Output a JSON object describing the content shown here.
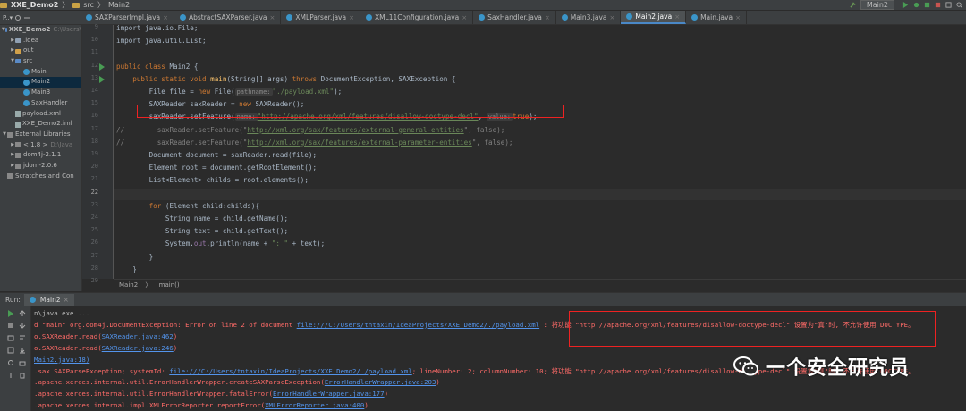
{
  "navbar": {
    "project": "XXE_Demo2",
    "sep": "〉",
    "folder": "src",
    "file": "Main2",
    "run_config": "Main2"
  },
  "project_tab": {
    "label": "P..▾"
  },
  "tabs": [
    {
      "label": "SAXParserImpl.java",
      "active": false
    },
    {
      "label": "AbstractSAXParser.java",
      "active": false
    },
    {
      "label": "XMLParser.java",
      "active": false
    },
    {
      "label": "XML11Configuration.java",
      "active": false
    },
    {
      "label": "SaxHandler.java",
      "active": false
    },
    {
      "label": "Main3.java",
      "active": false
    },
    {
      "label": "Main2.java",
      "active": true
    },
    {
      "label": "Main.java",
      "active": false
    }
  ],
  "tree": [
    {
      "indent": 0,
      "tri": "▼",
      "icon": "folder-blue",
      "label": "XXE_Demo2",
      "hint": "C:\\Users\\",
      "sel": false,
      "bold": true
    },
    {
      "indent": 1,
      "tri": "▶",
      "icon": "folder",
      "label": ".idea",
      "sel": false
    },
    {
      "indent": 1,
      "tri": "▶",
      "icon": "folder-orange",
      "label": "out",
      "sel": false
    },
    {
      "indent": 1,
      "tri": "▼",
      "icon": "folder-blue",
      "label": "src",
      "sel": false
    },
    {
      "indent": 2,
      "tri": "",
      "icon": "class",
      "label": "Main",
      "sel": false
    },
    {
      "indent": 2,
      "tri": "",
      "icon": "class",
      "label": "Main2",
      "sel": true
    },
    {
      "indent": 2,
      "tri": "",
      "icon": "class",
      "label": "Main3",
      "sel": false
    },
    {
      "indent": 2,
      "tri": "",
      "icon": "class",
      "label": "SaxHandler",
      "sel": false
    },
    {
      "indent": 1,
      "tri": "",
      "icon": "file",
      "label": "payload.xml",
      "sel": false
    },
    {
      "indent": 1,
      "tri": "",
      "icon": "file",
      "label": "XXE_Demo2.iml",
      "sel": false
    },
    {
      "indent": 0,
      "tri": "▼",
      "icon": "lib",
      "label": "External Libraries",
      "sel": false
    },
    {
      "indent": 1,
      "tri": "▶",
      "icon": "lib",
      "label": "< 1.8 >",
      "hint": "D:\\Java",
      "sel": false
    },
    {
      "indent": 1,
      "tri": "▶",
      "icon": "lib",
      "label": "dom4j-2.1.1",
      "sel": false
    },
    {
      "indent": 1,
      "tri": "▶",
      "icon": "lib",
      "label": "jdom-2.0.6",
      "sel": false
    },
    {
      "indent": 0,
      "tri": "",
      "icon": "lib",
      "label": "Scratches and Con",
      "sel": false
    }
  ],
  "editor": {
    "line_numbers": [
      "9",
      "10",
      "11",
      "12",
      "13",
      "14",
      "15",
      "16",
      "17",
      "18",
      "19",
      "20",
      "21",
      "22",
      "23",
      "24",
      "25",
      "26",
      "27",
      "28",
      "29"
    ],
    "lines": {
      "l9": "import java.io.File;",
      "l10": "import java.util.List;",
      "l12a": "public class ",
      "l12b": "Main2 {",
      "l13a": "    public static void ",
      "l13b": "main",
      "l13c": "(String[] args) ",
      "l13d": "throws ",
      "l13e": "DocumentException, SAXException {",
      "l14a": "        File file = ",
      "l14b": "new ",
      "l14c": "File(",
      "l14hint": "pathname:",
      "l14d": "\"./payload.xml\"",
      "l14e": ");",
      "l15a": "        SAXReader saxReader = ",
      "l15b": "new ",
      "l15c": "SAXReader();",
      "l16a": "        saxReader.setFeature(",
      "l16hint1": "name:",
      "l16b": "\"http://apache.org/xml/features/disallow-doctype-decl\"",
      "l16c": ", ",
      "l16hint2": "value:",
      "l16d": "true",
      "l16e": ");",
      "l17a": "//",
      "l17b": "        saxReader.setFeature(\"",
      "l17c": "http://xml.org/sax/features/external-general-entities",
      "l17d": "\", false);",
      "l18a": "//",
      "l18b": "        saxReader.setFeature(\"",
      "l18c": "http://xml.org/sax/features/external-parameter-entities",
      "l18d": "\", false);",
      "l19": "        Document document = saxReader.read(file);",
      "l20": "        Element root = document.getRootElement();",
      "l21a": "        List<Element> ",
      "l21b": "childs",
      "l21c": " = root.elements();",
      "l23a": "        ",
      "l23b": "for ",
      "l23c": "(Element child:childs){",
      "l24": "            String name = child.getName();",
      "l25": "            String text = child.getText();",
      "l26a": "            System.",
      "l26b": "out",
      "l26c": ".println(name + ",
      "l26d": "\": \"",
      "l26e": " + text);",
      "l27": "        }",
      "l28": "    }",
      "l29": "}"
    },
    "breadcrumb": [
      "Main2",
      "〉",
      "main()"
    ]
  },
  "run": {
    "label": "Run:",
    "tab": "Main2",
    "console": {
      "c1": "n\\java.exe ...",
      "c2a": "d \"main\" org.dom4j.DocumentException: Error on line 2 of document ",
      "c2b": "file:///C:/Users/tntaxin/IdeaProjects/XXE_Demo2/./payload.xml",
      "c2c": " : 将功能 \"http://apache.org/xml/features/disallow-doctype-decl\" 设置为\"真\"时, 不允许使用 DOCTYPE。",
      "c3a": "o.SAXReader.read(",
      "c3b": "SAXReader.java:462",
      "c3c": ")",
      "c4a": "o.SAXReader.read(",
      "c4b": "SAXReader.java:246",
      "c4c": ")",
      "c5": "Main2.java:18)",
      "c6a": ".sax.SAXParseException; systemId: ",
      "c6b": "file:///C:/Users/tntaxin/IdeaProjects/XXE_Demo2/./payload.xml",
      "c6c": "; lineNumber: 2; columnNumber: 10; 将功能 \"http://apache.org/xml/features/disallow-doctype-decl\" 设置为\"真\"时, 不允许使用 DOCTYPE。",
      "c7a": ".apache.xerces.internal.util.ErrorHandlerWrapper.createSAXParseException(",
      "c7b": "ErrorHandlerWrapper.java:203",
      "c7c": ")",
      "c8a": ".apache.xerces.internal.util.ErrorHandlerWrapper.fatalError(",
      "c8b": "ErrorHandlerWrapper.java:177",
      "c8c": ")",
      "c9a": ".apache.xerces.internal.impl.XMLErrorReporter.reportError(",
      "c9b": "XMLErrorReporter.java:400",
      "c9c": ")"
    }
  },
  "watermark": {
    "text": "一个安全研究员"
  },
  "colors": {
    "accent": "#4a88c7",
    "highlight_box": "#ee2222",
    "error_text": "#ff6b68",
    "keyword": "#cc7832",
    "string": "#6a8759"
  }
}
